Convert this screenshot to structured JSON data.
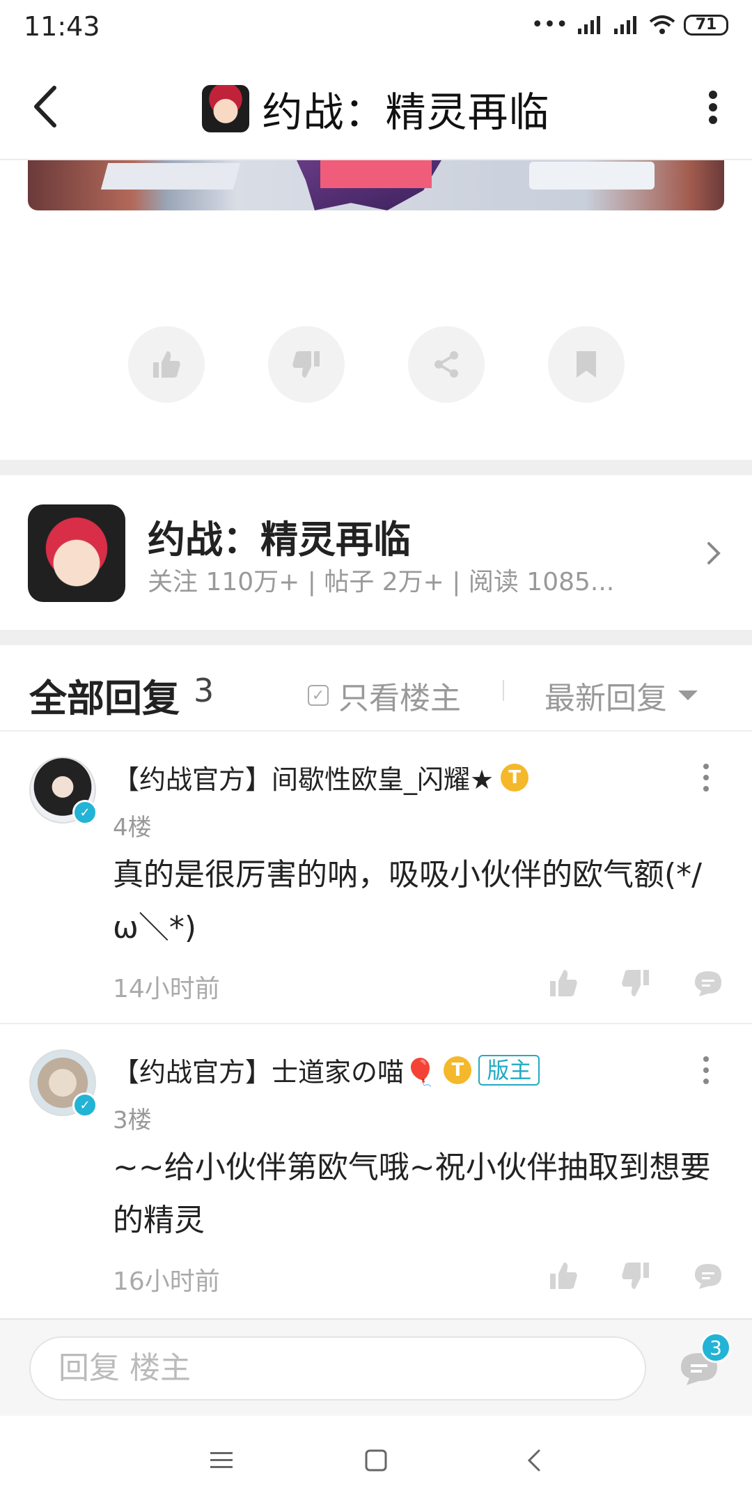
{
  "status_bar": {
    "time": "11:43",
    "battery": "71"
  },
  "header": {
    "title": "约战：精灵再临"
  },
  "forum": {
    "name": "约战：精灵再临",
    "stats": "关注 110万+  |  帖子 2万+  |  阅读 1085..."
  },
  "replies": {
    "title": "全部回复",
    "count": "3",
    "only_op": "只看楼主",
    "sort": "最新回复"
  },
  "comments": [
    {
      "user": "【约战官方】间歇性欧皇_闪耀★",
      "coin": "T",
      "floor": "4楼",
      "text": "真的是很厉害的呐，吸吸小伙伴的欧气额(*/ω＼*)",
      "time": "14小时前"
    },
    {
      "user": "【约战官方】士道家の喵🎈",
      "coin": "T",
      "mod_tag": "版主",
      "floor": "3楼",
      "text": "~~给小伙伴第欧气哦~祝小伙伴抽取到想要的精灵",
      "time": "16小时前"
    }
  ],
  "reply_bar": {
    "placeholder": "回复  楼主",
    "badge": "3"
  },
  "colors": {
    "accent": "#23b3d5",
    "coin": "#f4b82a",
    "muted": "#999999"
  }
}
